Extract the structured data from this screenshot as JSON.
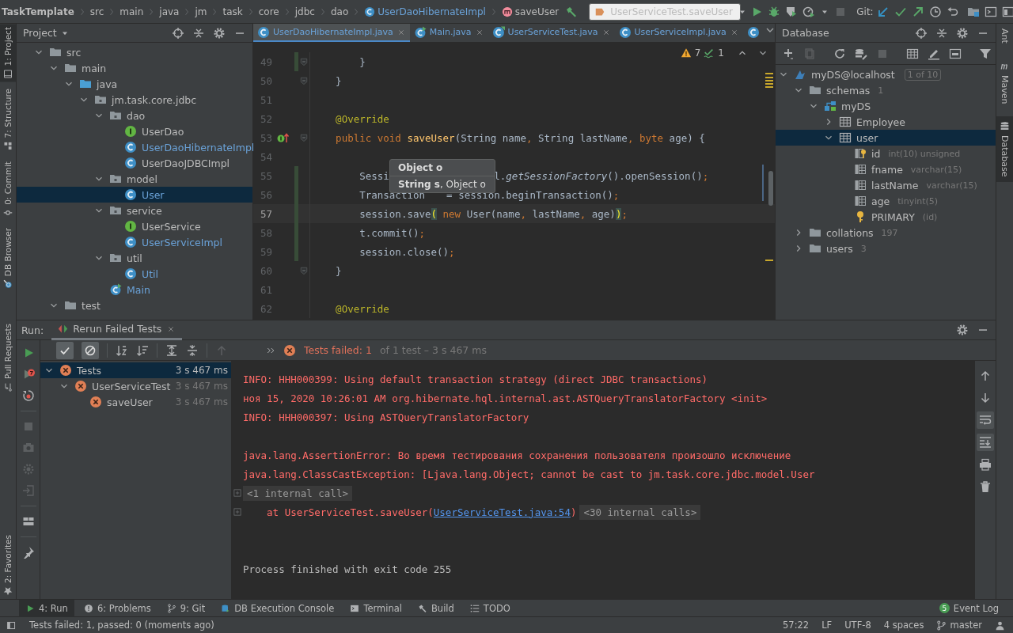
{
  "breadcrumbs": [
    {
      "label": "TaskTemplate",
      "kind": "project"
    },
    {
      "label": "src",
      "kind": "dir"
    },
    {
      "label": "main",
      "kind": "dir"
    },
    {
      "label": "java",
      "kind": "dir"
    },
    {
      "label": "jm",
      "kind": "dir"
    },
    {
      "label": "task",
      "kind": "dir"
    },
    {
      "label": "core",
      "kind": "dir"
    },
    {
      "label": "jdbc",
      "kind": "dir"
    },
    {
      "label": "dao",
      "kind": "dir"
    },
    {
      "label": "UserDaoHibernateImpl",
      "kind": "class"
    },
    {
      "label": "saveUser",
      "kind": "method"
    }
  ],
  "run_config": {
    "label": "UserServiceTest.saveUser"
  },
  "vcs_label": "Git:",
  "left_stripe": [
    {
      "label": "1: Project",
      "selected": true
    },
    {
      "label": "7: Structure",
      "selected": false
    },
    {
      "label": "0: Commit",
      "selected": false
    },
    {
      "label": "DB Browser",
      "selected": false
    },
    {
      "label": "Pull Requests",
      "selected": false
    },
    {
      "label": "2: Favorites",
      "selected": false
    }
  ],
  "right_stripe": [
    {
      "label": "Ant",
      "selected": false
    },
    {
      "label": "Maven",
      "selected": false
    },
    {
      "label": "Database",
      "selected": true
    }
  ],
  "project": {
    "title": "Project",
    "tree": [
      {
        "label": "src",
        "kind": "folder",
        "expanded": true,
        "selected": false,
        "modified": false,
        "children": [
          {
            "label": "main",
            "kind": "folder",
            "expanded": true,
            "selected": false,
            "modified": false,
            "children": [
              {
                "label": "java",
                "kind": "source-folder",
                "expanded": true,
                "selected": false,
                "modified": false,
                "children": [
                  {
                    "label": "jm.task.core.jdbc",
                    "kind": "package",
                    "expanded": true,
                    "selected": false,
                    "modified": false,
                    "children": [
                      {
                        "label": "dao",
                        "kind": "package",
                        "expanded": true,
                        "selected": false,
                        "modified": false,
                        "children": [
                          {
                            "label": "UserDao",
                            "kind": "interface",
                            "selected": false,
                            "modified": false
                          },
                          {
                            "label": "UserDaoHibernateImpl",
                            "kind": "class",
                            "selected": false,
                            "modified": true
                          },
                          {
                            "label": "UserDaoJDBCImpl",
                            "kind": "class",
                            "selected": false,
                            "modified": false
                          }
                        ]
                      },
                      {
                        "label": "model",
                        "kind": "package",
                        "expanded": true,
                        "selected": false,
                        "modified": false,
                        "children": [
                          {
                            "label": "User",
                            "kind": "class",
                            "selected": true,
                            "modified": true
                          }
                        ]
                      },
                      {
                        "label": "service",
                        "kind": "package",
                        "expanded": true,
                        "selected": false,
                        "modified": false,
                        "children": [
                          {
                            "label": "UserService",
                            "kind": "interface",
                            "selected": false,
                            "modified": false
                          },
                          {
                            "label": "UserServiceImpl",
                            "kind": "class",
                            "selected": false,
                            "modified": true
                          }
                        ]
                      },
                      {
                        "label": "util",
                        "kind": "package",
                        "expanded": true,
                        "selected": false,
                        "modified": false,
                        "children": [
                          {
                            "label": "Util",
                            "kind": "class",
                            "selected": false,
                            "modified": true
                          }
                        ]
                      },
                      {
                        "label": "Main",
                        "kind": "main-class",
                        "selected": false,
                        "modified": true
                      }
                    ]
                  }
                ]
              }
            ]
          },
          {
            "label": "test",
            "kind": "folder",
            "expanded": true,
            "selected": false,
            "modified": false
          }
        ]
      }
    ]
  },
  "editor": {
    "tabs": [
      {
        "label": "UserDaoHibernateImpl.java",
        "kind": "class",
        "selected": true
      },
      {
        "label": "Main.java",
        "kind": "main-class",
        "selected": false
      },
      {
        "label": "UserServiceTest.java",
        "kind": "test-class",
        "selected": false
      },
      {
        "label": "UserServiceImpl.java",
        "kind": "class",
        "selected": false
      },
      {
        "kind": "class",
        "selected": false
      }
    ],
    "inspections": {
      "warnings": "7",
      "weak_warnings": "1"
    },
    "lines": [
      {
        "number": "49",
        "current": false,
        "changed": true,
        "fold": true,
        "tokens": [
          {
            "text": "        }",
            "kind": "plain"
          }
        ]
      },
      {
        "number": "50",
        "current": false,
        "changed": false,
        "fold": true,
        "tokens": [
          {
            "text": "    }",
            "kind": "plain"
          }
        ]
      },
      {
        "number": "51",
        "current": false,
        "changed": false,
        "fold": false
      },
      {
        "number": "52",
        "current": false,
        "changed": false,
        "fold": false,
        "tokens": [
          {
            "text": "    @Override",
            "kind": "annotation"
          }
        ]
      },
      {
        "number": "53",
        "current": false,
        "changed": false,
        "fold": true,
        "implements": true,
        "tokens": [
          {
            "text": "    public void ",
            "kind": "keyword"
          },
          {
            "text": "saveUser",
            "kind": "declaration"
          },
          {
            "text": "(String name",
            "kind": "plain"
          },
          {
            "text": ", ",
            "kind": "punct"
          },
          {
            "text": "String lastName",
            "kind": "plain"
          },
          {
            "text": ", ",
            "kind": "punct"
          },
          {
            "text": "byte ",
            "kind": "keyword"
          },
          {
            "text": "age) {",
            "kind": "plain"
          }
        ]
      },
      {
        "number": "54",
        "current": false,
        "changed": false,
        "fold": false
      },
      {
        "number": "55",
        "current": false,
        "changed": true,
        "fold": false,
        "tokens": [
          {
            "text": "        Sessi",
            "kind": "plain"
          },
          {
            "kind": "gap"
          },
          {
            "text": "l.",
            "kind": "plain"
          },
          {
            "text": "getSessionFactory",
            "kind": "static"
          },
          {
            "text": "().openSession()",
            "kind": "plain"
          },
          {
            "text": ";",
            "kind": "punct"
          }
        ]
      },
      {
        "number": "56",
        "current": false,
        "changed": true,
        "fold": false,
        "tokens": [
          {
            "text": "        Transaction",
            "kind": "plain"
          },
          {
            "kind": "gap"
          },
          {
            "text": "= session.beginTransaction()",
            "kind": "plain"
          },
          {
            "text": ";",
            "kind": "punct"
          }
        ]
      },
      {
        "number": "57",
        "current": true,
        "changed": true,
        "fold": false,
        "tokens": [
          {
            "text": "        session.save",
            "kind": "plain"
          },
          {
            "text": "(",
            "kind": "brace"
          },
          {
            "text": " new ",
            "kind": "keyword"
          },
          {
            "text": "User(name",
            "kind": "plain"
          },
          {
            "text": ", ",
            "kind": "punct"
          },
          {
            "text": "lastName",
            "kind": "plain"
          },
          {
            "text": ", ",
            "kind": "punct"
          },
          {
            "text": "age)",
            "kind": "plain"
          },
          {
            "text": ")",
            "kind": "brace"
          },
          {
            "text": ";",
            "kind": "punct"
          }
        ]
      },
      {
        "number": "58",
        "current": false,
        "changed": true,
        "fold": false,
        "tokens": [
          {
            "text": "        t.commit()",
            "kind": "plain"
          },
          {
            "text": ";",
            "kind": "punct"
          }
        ]
      },
      {
        "number": "59",
        "current": false,
        "changed": true,
        "fold": false,
        "tokens": [
          {
            "text": "        session.close()",
            "kind": "plain"
          },
          {
            "text": ";",
            "kind": "punct"
          }
        ]
      },
      {
        "number": "60",
        "current": false,
        "changed": false,
        "fold": true,
        "tokens": [
          {
            "text": "    }",
            "kind": "plain"
          }
        ]
      },
      {
        "number": "61",
        "current": false,
        "changed": false,
        "fold": false
      },
      {
        "number": "62",
        "current": false,
        "changed": false,
        "fold": false,
        "tokens": [
          {
            "text": "    @Override",
            "kind": "annotation"
          }
        ]
      }
    ],
    "parameter_hint": [
      {
        "text": "Object o",
        "current": true
      },
      {
        "text": "**String s**, Object o",
        "current": false
      }
    ]
  },
  "database": {
    "title": "Database",
    "tree": [
      {
        "label": "myDS@localhost",
        "badge": "1 of 10",
        "kind": "server",
        "expanded": true,
        "selected": false,
        "children": [
          {
            "label": "schemas",
            "detail": "1",
            "kind": "folder",
            "expanded": true,
            "selected": false,
            "children": [
              {
                "label": "myDS",
                "kind": "schema",
                "expanded": true,
                "selected": false,
                "children": [
                  {
                    "label": "Employee",
                    "kind": "table",
                    "expanded": false,
                    "selected": false
                  },
                  {
                    "label": "user",
                    "kind": "table",
                    "expanded": true,
                    "selected": true,
                    "children": [
                      {
                        "label": "id",
                        "detail": "int(10) unsigned",
                        "kind": "key-column",
                        "selected": false
                      },
                      {
                        "label": "fname",
                        "detail": "varchar(15)",
                        "kind": "column",
                        "selected": false
                      },
                      {
                        "label": "lastName",
                        "detail": "varchar(15)",
                        "kind": "column",
                        "selected": false
                      },
                      {
                        "label": "age",
                        "detail": "tinyint(5)",
                        "kind": "column",
                        "selected": false
                      },
                      {
                        "label": "PRIMARY",
                        "detail": "(id)",
                        "kind": "index",
                        "selected": false
                      }
                    ]
                  }
                ]
              }
            ]
          },
          {
            "label": "collations",
            "detail": "197",
            "kind": "folder",
            "expanded": false,
            "selected": false
          },
          {
            "label": "users",
            "detail": "3",
            "kind": "folder",
            "expanded": false,
            "selected": false
          }
        ]
      }
    ]
  },
  "run": {
    "label": "Run:",
    "tabs": [
      {
        "label": "Rerun Failed Tests",
        "selected": true
      }
    ],
    "toggles": [
      {
        "kind": "check",
        "on": true
      },
      {
        "kind": "cancel",
        "on": true
      }
    ],
    "status": {
      "failed": "Tests failed: 1",
      "summary": "of 1 test – 3 s 467 ms"
    },
    "tests": [
      {
        "label": "Tests",
        "time": "3 s 467 ms",
        "failed": true,
        "expanded": true,
        "selected": true,
        "children": [
          {
            "label": "UserServiceTest",
            "time": "3 s 467 ms",
            "failed": true,
            "expanded": true,
            "selected": false,
            "children": [
              {
                "label": "saveUser",
                "time": "3 s 467 ms",
                "failed": true,
                "selected": false
              }
            ]
          }
        ]
      }
    ],
    "console": [
      {
        "kind": "error",
        "text": "INFO: HHH000399: Using default transaction strategy (direct JDBC transactions)"
      },
      {
        "kind": "error",
        "text": "ноя 15, 2020 10:26:01 AM org.hibernate.hql.internal.ast.ASTQueryTranslatorFactory <init>"
      },
      {
        "kind": "error",
        "text": "INFO: HHH000397: Using ASTQueryTranslatorFactory"
      },
      {
        "kind": "spacer"
      },
      {
        "kind": "error",
        "text": "java.lang.AssertionError: Во время тестирования сохранения пользователя произошло исключение"
      },
      {
        "kind": "error",
        "text": "java.lang.ClassCastException: [Ljava.lang.Object; cannot be cast to jm.task.core.jdbc.model.User"
      },
      {
        "kind": "fold",
        "text": "<1 internal call>"
      },
      {
        "kind": "stack",
        "text": "at UserServiceTest.saveUser(",
        "link": "UserServiceTest.java:54",
        "suffix": ")",
        "fold": "<30 internal calls>"
      },
      {
        "kind": "spacer"
      },
      {
        "kind": "spacer"
      },
      {
        "kind": "normal",
        "text": "Process finished with exit code 255"
      }
    ]
  },
  "tool_windows": [
    {
      "label": "4: Run",
      "selected": true
    },
    {
      "label": "6: Problems",
      "selected": false
    },
    {
      "label": "9: Git",
      "selected": false
    },
    {
      "label": "DB Execution Console",
      "selected": false
    },
    {
      "label": "Terminal",
      "selected": false
    },
    {
      "label": "Build",
      "selected": false
    },
    {
      "label": "TODO",
      "selected": false
    }
  ],
  "event_log": {
    "label": "Event Log",
    "badge": "5"
  },
  "status_bar": {
    "message": "Tests failed: 1, passed: 0 (moments ago)",
    "position": "57:22",
    "line_separator": "LF",
    "encoding": "UTF-8",
    "indent": "4 spaces",
    "branch": "master"
  }
}
